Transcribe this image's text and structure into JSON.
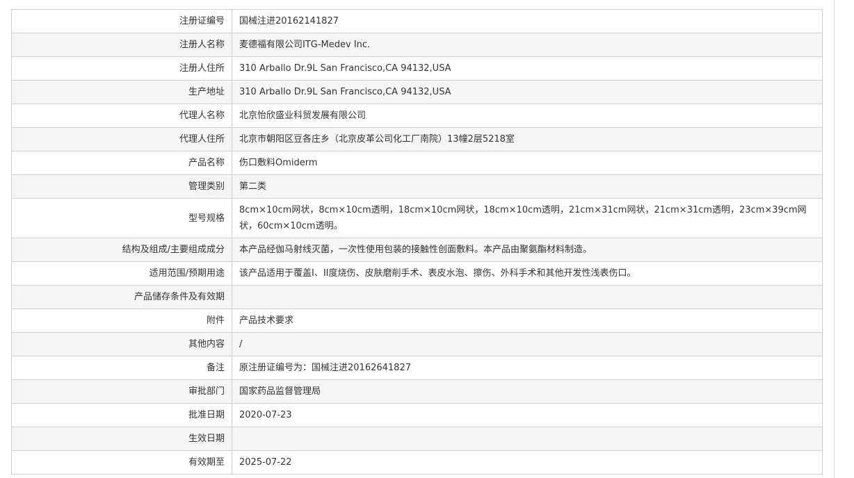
{
  "rows": [
    {
      "label": "注册证编号",
      "value": "国械注进20162141827"
    },
    {
      "label": "注册人名称",
      "value": "麦德福有限公司ITG-Medev Inc."
    },
    {
      "label": "注册人住所",
      "value": "310 Arballo Dr.9L San Francisco,CA 94132,USA"
    },
    {
      "label": "生产地址",
      "value": "310 Arballo Dr.9L San Francisco,CA 94132,USA"
    },
    {
      "label": "代理人名称",
      "value": "北京怡欣盛业科贸发展有限公司"
    },
    {
      "label": "代理人住所",
      "value": "北京市朝阳区豆各庄乡（北京皮革公司化工厂南院）13幢2层5218室"
    },
    {
      "label": "产品名称",
      "value": "伤口敷料Omiderm"
    },
    {
      "label": "管理类别",
      "value": "第二类"
    },
    {
      "label": "型号规格",
      "value": "8cm×10cm网状，8cm×10cm透明，18cm×10cm网状，18cm×10cm透明，21cm×31cm网状，21cm×31cm透明，23cm×39cm网状，60cm×10cm透明。"
    },
    {
      "label": "结构及组成/主要组成成分",
      "value": "本产品经伽马射线灭菌，一次性使用包装的接触性创面敷料。本产品由聚氨酯材料制造。"
    },
    {
      "label": "适用范围/预期用途",
      "value": "该产品适用于覆盖I、II度烧伤、皮肤磨削手术、表皮水泡、擦伤、外科手术和其他开发性浅表伤口。"
    },
    {
      "label": "产品储存条件及有效期",
      "value": ""
    },
    {
      "label": "附件",
      "value": "产品技术要求"
    },
    {
      "label": "其他内容",
      "value": "/"
    },
    {
      "label": "备注",
      "value": "原注册证编号为：国械注进20162641827"
    },
    {
      "label": "审批部门",
      "value": "国家药品监督管理局"
    },
    {
      "label": "批准日期",
      "value": "2020-07-23"
    },
    {
      "label": "生效日期",
      "value": ""
    },
    {
      "label": "有效期至",
      "value": "2025-07-22"
    }
  ]
}
